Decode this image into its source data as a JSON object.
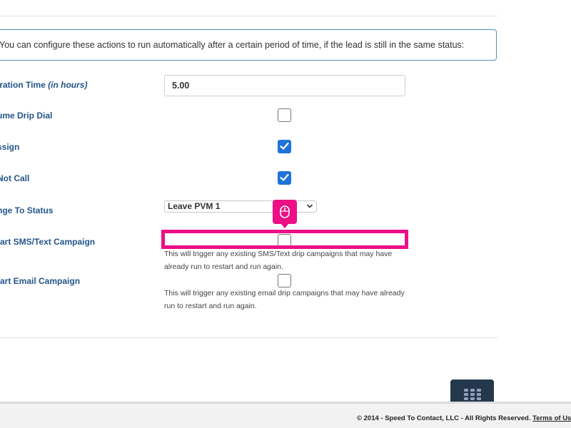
{
  "info": {
    "text": "You can configure these actions to run automatically after a certain period of time, if the lead is still in the same status:"
  },
  "fields": {
    "expiration": {
      "label_main": "iration Time ",
      "label_unit": "(in hours)",
      "value": "5.00"
    },
    "resume_drip_dial": {
      "label": "ume Drip Dial",
      "checked": false
    },
    "reassign": {
      "label": "ssign",
      "checked": true
    },
    "do_not_call": {
      "label": "Not Call",
      "checked": true
    },
    "change_status": {
      "label": "nge To Status",
      "selected": "Leave PVM 1"
    },
    "restart_sms": {
      "label": "tart SMS/Text Campaign",
      "checked": false,
      "help": "This will trigger any existing SMS/Text drip campaigns that may have already run to restart and run again."
    },
    "restart_email": {
      "label": "tart Email Campaign",
      "checked": false,
      "help": "This will trigger any existing email drip campaigns that may have already run to restart and run again."
    }
  },
  "footer": {
    "copyright": "© 2014 - Speed To Contact, LLC - All Rights Reserved. ",
    "terms": "Terms of Use Pr"
  },
  "icons": {
    "mouse": "mouse-icon",
    "apps": "grid-apps-icon"
  },
  "colors": {
    "label": "#24558a",
    "checkbox": "#1e73d9",
    "highlight": "#ec0f86",
    "app_button": "#23384d"
  }
}
